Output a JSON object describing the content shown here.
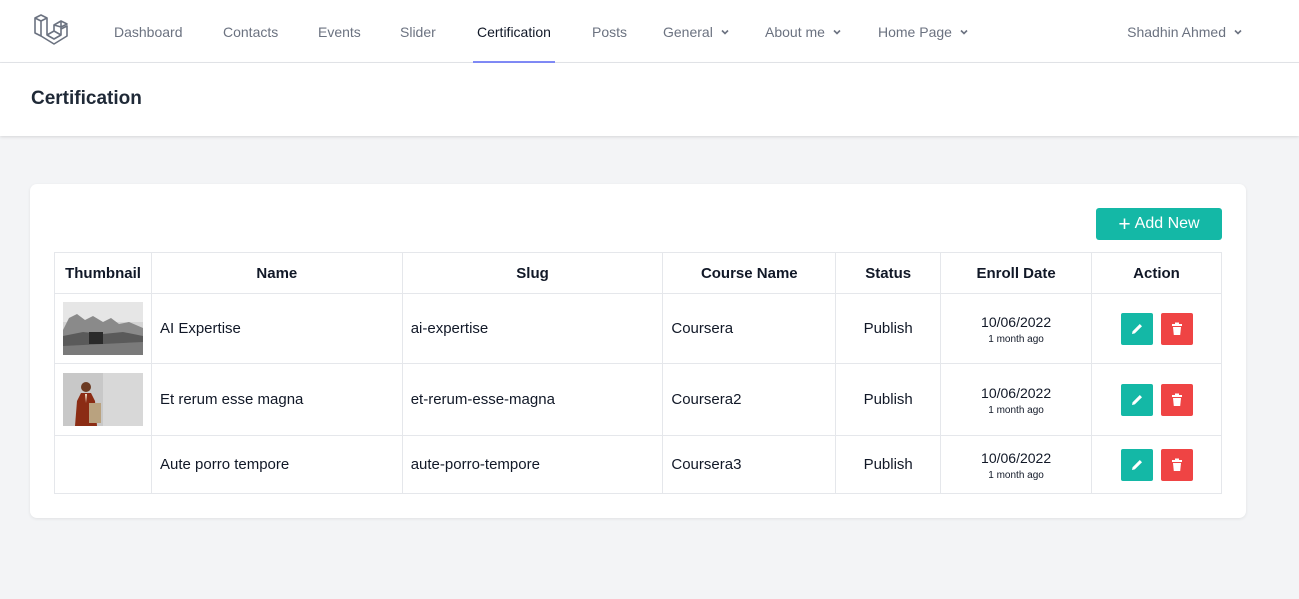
{
  "nav": {
    "items": [
      {
        "label": "Dashboard"
      },
      {
        "label": "Contacts"
      },
      {
        "label": "Events"
      },
      {
        "label": "Slider"
      },
      {
        "label": "Certification"
      },
      {
        "label": "Posts"
      },
      {
        "label": "General"
      },
      {
        "label": "About me"
      },
      {
        "label": "Home Page"
      }
    ],
    "active": "Certification",
    "user": "Shadhin Ahmed"
  },
  "header": {
    "title": "Certification"
  },
  "toolbar": {
    "add_label": "Add New"
  },
  "table": {
    "columns": [
      "Thumbnail",
      "Name",
      "Slug",
      "Course Name",
      "Status",
      "Enroll Date",
      "Action"
    ],
    "rows": [
      {
        "name": "AI Expertise",
        "slug": "ai-expertise",
        "course": "Coursera",
        "status": "Publish",
        "date": "10/06/2022",
        "ago": "1 month ago"
      },
      {
        "name": "Et rerum esse magna",
        "slug": "et-rerum-esse-magna",
        "course": "Coursera2",
        "status": "Publish",
        "date": "10/06/2022",
        "ago": "1 month ago"
      },
      {
        "name": "Aute porro tempore",
        "slug": "aute-porro-tempore",
        "course": "Coursera3",
        "status": "Publish",
        "date": "10/06/2022",
        "ago": "1 month ago"
      }
    ]
  },
  "colors": {
    "accent": "#14b8a6",
    "danger": "#ef4444",
    "active_underline": "#818cf8"
  }
}
